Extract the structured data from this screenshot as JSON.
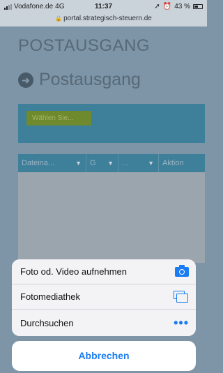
{
  "status_bar": {
    "carrier": "Vodafone.de",
    "network": "4G",
    "time": "11:37",
    "battery": "43 %",
    "url": "portal.strategisch-steuern.de"
  },
  "page": {
    "heading": "POSTAUSGANG",
    "subheading": "Postausgang",
    "select_label": "Wählen Sie...",
    "columns": [
      "Dateina...",
      "G",
      "...",
      "Aktion"
    ]
  },
  "action_sheet": {
    "items": [
      {
        "label": "Foto od. Video aufnehmen",
        "icon": "camera-icon"
      },
      {
        "label": "Fotomediathek",
        "icon": "photo-library-icon"
      },
      {
        "label": "Durchsuchen",
        "icon": "more-icon"
      }
    ],
    "cancel_label": "Abbrechen"
  },
  "colors": {
    "accent": "#1a7cf2",
    "header_bar": "#3e7f9a",
    "select_button": "#6f8a2c"
  }
}
